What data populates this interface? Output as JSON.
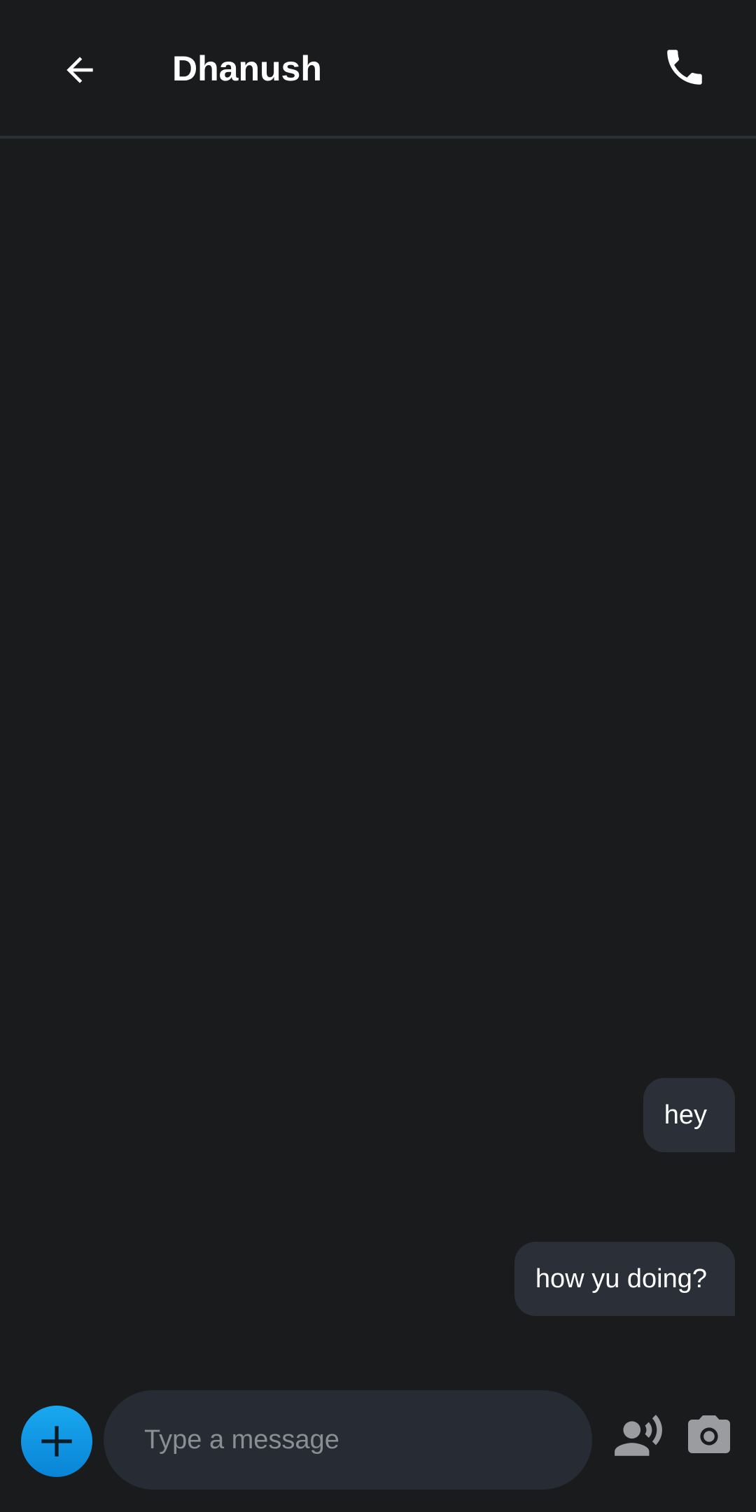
{
  "header": {
    "contact_name": "Dhanush",
    "back_icon": "arrow-left-icon",
    "call_icon": "phone-icon"
  },
  "messages": [
    {
      "text": "hey",
      "direction": "outgoing"
    },
    {
      "text": "how yu doing?",
      "direction": "outgoing"
    }
  ],
  "composer": {
    "placeholder": "Type a message",
    "value": "",
    "add_icon": "plus-icon",
    "voice_icon": "voice-person-icon",
    "camera_icon": "camera-icon"
  },
  "colors": {
    "background": "#1a1b1d",
    "bubble": "#2b3038",
    "input_background": "#272b33",
    "accent": "#0a9be8",
    "icon_muted": "#9a9ca0"
  }
}
